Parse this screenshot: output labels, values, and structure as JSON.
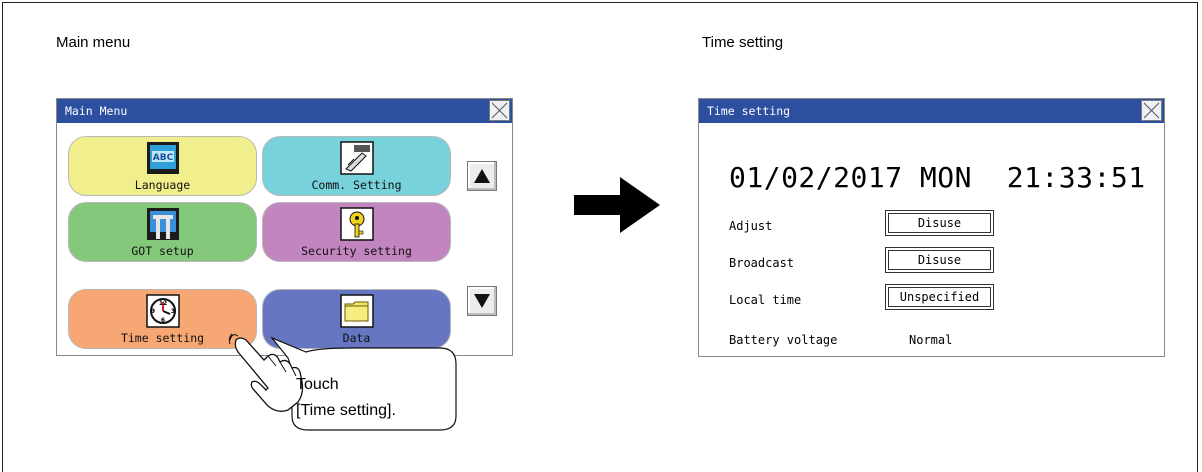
{
  "captions": {
    "left": "Main menu",
    "right": "Time setting"
  },
  "main_menu": {
    "title": "Main Menu",
    "tiles": [
      {
        "label": "Language",
        "color": "#f1ef8c",
        "icon": "language-abc-icon"
      },
      {
        "label": "Comm. Setting",
        "color": "#77d2dc",
        "icon": "comm-connector-icon"
      },
      {
        "label": "GOT setup",
        "color": "#84c87c",
        "icon": "got-setup-tools-icon"
      },
      {
        "label": "Security setting",
        "color": "#c285bf",
        "icon": "security-key-icon"
      },
      {
        "label": "Time setting",
        "color": "#f7a773",
        "icon": "clock-icon"
      },
      {
        "label": "Data",
        "color": "#6676c3",
        "icon": "folder-icon"
      }
    ]
  },
  "callout": {
    "line1": "Touch",
    "line2": "[Time setting]."
  },
  "time_setting": {
    "title": "Time setting",
    "datetime": "01/02/2017 MON  21:33:51",
    "rows": [
      {
        "label": "Adjust",
        "value": "Disuse"
      },
      {
        "label": "Broadcast",
        "value": "Disuse"
      },
      {
        "label": "Local time",
        "value": "Unspecified"
      }
    ],
    "battery": {
      "label": "Battery voltage",
      "value": "Normal"
    }
  },
  "colors": {
    "titlebar": "#2d4fa0",
    "arrow": "#000000"
  }
}
